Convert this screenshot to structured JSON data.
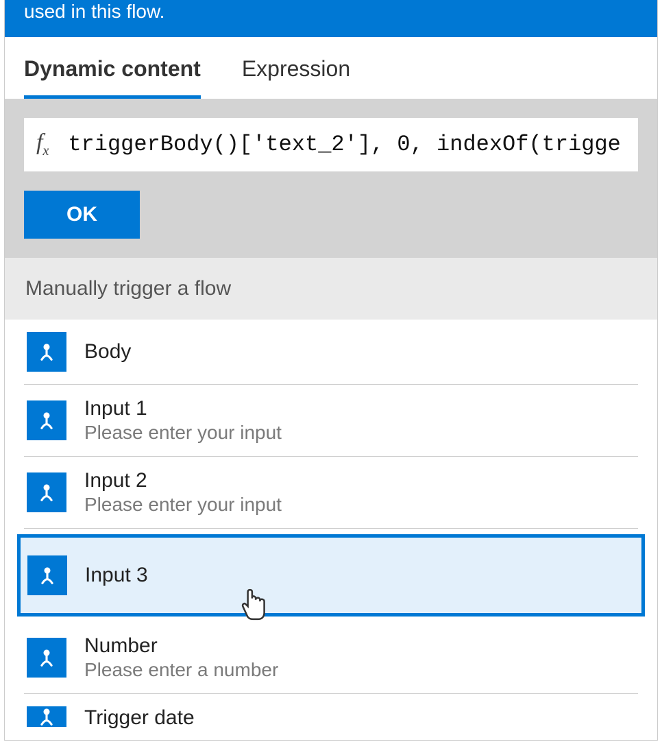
{
  "banner": {
    "text": "used in this flow."
  },
  "tabs": {
    "dynamic": "Dynamic content",
    "expression": "Expression"
  },
  "expression": {
    "fx": "fx",
    "value": "triggerBody()['text_2'], 0, indexOf(trigge",
    "ok": "OK"
  },
  "section": {
    "title": "Manually trigger a flow"
  },
  "items": [
    {
      "title": "Body",
      "desc": ""
    },
    {
      "title": "Input 1",
      "desc": "Please enter your input"
    },
    {
      "title": "Input 2",
      "desc": "Please enter your input"
    },
    {
      "title": "Input 3",
      "desc": ""
    },
    {
      "title": "Number",
      "desc": "Please enter a number"
    },
    {
      "title": "Trigger date",
      "desc": ""
    }
  ]
}
